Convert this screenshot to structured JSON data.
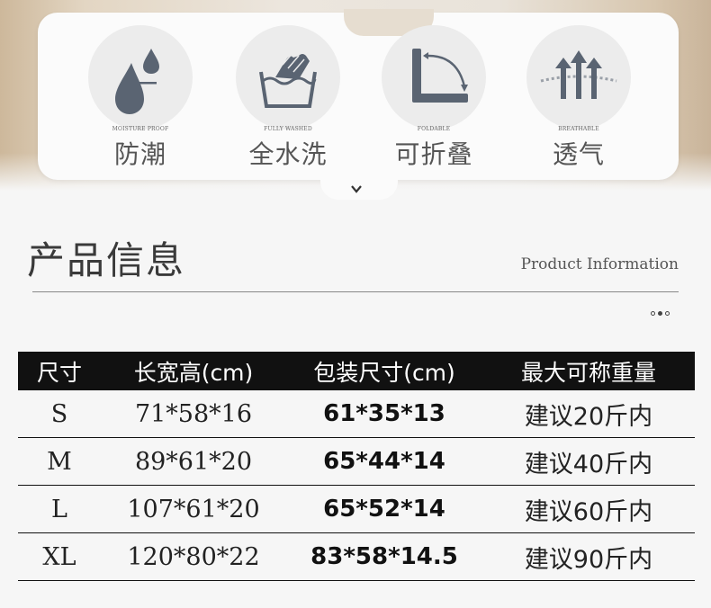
{
  "features": [
    {
      "icon": "moisture-drop-icon",
      "en": "MOISTURE PROOF",
      "zh": "防潮"
    },
    {
      "icon": "hand-wash-icon",
      "en": "FULLY WASHED",
      "zh": "全水洗"
    },
    {
      "icon": "foldable-icon",
      "en": "FOLDABLE",
      "zh": "可折叠"
    },
    {
      "icon": "breathable-icon",
      "en": "BREATHABLE",
      "zh": "透气"
    }
  ],
  "section": {
    "title": "产品信息",
    "subtitle": "Product Information"
  },
  "table": {
    "headers": [
      "尺寸",
      "长宽高(cm)",
      "包装尺寸(cm)",
      "最大可称重量"
    ],
    "rows": [
      [
        "S",
        "71*58*16",
        "61*35*13",
        "建议20斤内"
      ],
      [
        "M",
        "89*61*20",
        "65*44*14",
        "建议40斤内"
      ],
      [
        "L",
        "107*61*20",
        "65*52*14",
        "建议60斤内"
      ],
      [
        "XL",
        "120*80*22",
        "83*58*14.5",
        "建议90斤内"
      ]
    ]
  }
}
